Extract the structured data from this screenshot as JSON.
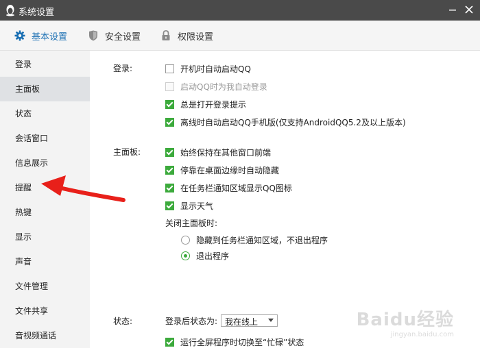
{
  "window": {
    "title": "系统设置",
    "colors": {
      "titlebar": "#4a4a4a",
      "accent": "#1a6fb3",
      "check": "#3caa3c",
      "arrow": "#e8201a"
    }
  },
  "tabs": [
    {
      "label": "基本设置",
      "icon": "gear-icon",
      "active": true
    },
    {
      "label": "安全设置",
      "icon": "shield-icon",
      "active": false
    },
    {
      "label": "权限设置",
      "icon": "lock-icon",
      "active": false
    }
  ],
  "sidebar": {
    "items": [
      {
        "label": "登录",
        "selected": false
      },
      {
        "label": "主面板",
        "selected": true
      },
      {
        "label": "状态",
        "selected": false
      },
      {
        "label": "会话窗口",
        "selected": false
      },
      {
        "label": "信息展示",
        "selected": false
      },
      {
        "label": "提醒",
        "selected": false
      },
      {
        "label": "热键",
        "selected": false
      },
      {
        "label": "显示",
        "selected": false
      },
      {
        "label": "声音",
        "selected": false
      },
      {
        "label": "文件管理",
        "selected": false
      },
      {
        "label": "文件共享",
        "selected": false
      },
      {
        "label": "音视频通话",
        "selected": false
      }
    ]
  },
  "sections": {
    "login": {
      "label": "登录:",
      "options": [
        {
          "text": "开机时自动启动QQ",
          "checked": false,
          "disabled": false
        },
        {
          "text": "启动QQ时为我自动登录",
          "checked": false,
          "disabled": true
        },
        {
          "text": "总是打开登录提示",
          "checked": true,
          "disabled": false
        },
        {
          "text": "离线时自动启动QQ手机版(仅支持AndroidQQ5.2及以上版本)",
          "checked": true,
          "disabled": false
        }
      ]
    },
    "main_panel": {
      "label": "主面板:",
      "options": [
        {
          "text": "始终保持在其他窗口前端",
          "checked": true
        },
        {
          "text": "停靠在桌面边缘时自动隐藏",
          "checked": true
        },
        {
          "text": "在任务栏通知区域显示QQ图标",
          "checked": true
        },
        {
          "text": "显示天气",
          "checked": true
        }
      ],
      "close_label": "关闭主面板时:",
      "close_options": [
        {
          "text": "隐藏到任务栏通知区域，不退出程序",
          "checked": false
        },
        {
          "text": "退出程序",
          "checked": true
        }
      ]
    },
    "status": {
      "label": "状态:",
      "after_login_label": "登录后状态为:",
      "after_login_value": "我在线上",
      "fullscreen_option": {
        "text": "运行全屏程序时切换至“忙碌”状态",
        "checked": true
      }
    }
  },
  "watermark": {
    "main": "Baidu经验",
    "sub": "jingyan.baidu.com"
  }
}
